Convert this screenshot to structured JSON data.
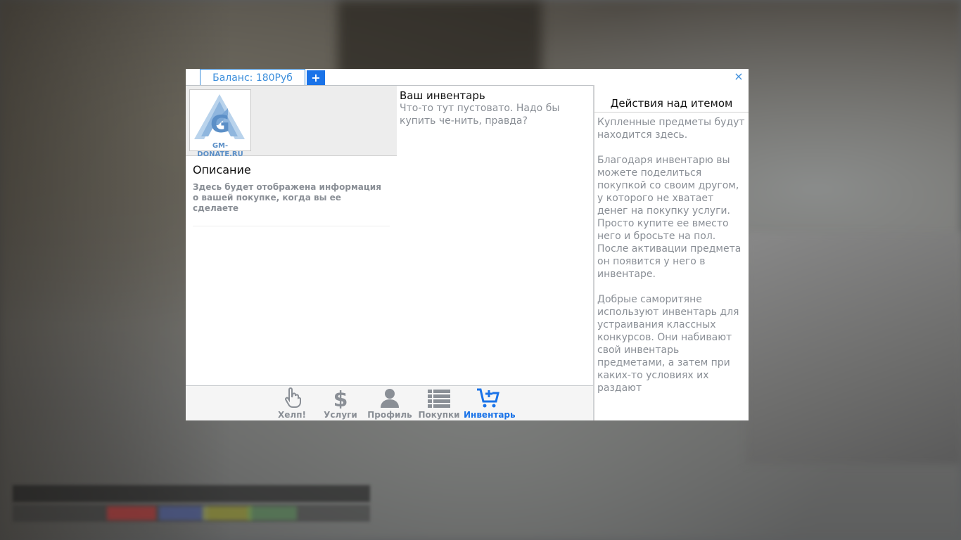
{
  "window": {
    "balance_label": "Баланс: 180Руб",
    "add_balance_label": "+",
    "close_label": "×",
    "accent_color": "#1a73e8"
  },
  "logo": {
    "text": "GM-DONATE.RU",
    "icon": "gm-donate-logo"
  },
  "description": {
    "title": "Описание",
    "text": "Здесь будет отображена информация о вашей покупке, когда вы ее сделаете"
  },
  "inventory": {
    "title": "Ваш инвентарь",
    "empty_text": "Что-то тут пустовато. Надо бы купить че-нить, правда?"
  },
  "actions_panel": {
    "title": "Действия над итемом",
    "paragraphs": [
      "Купленные предметы будут находится здесь.",
      "Благодаря инвентарю вы можете поделиться покупкой со своим другом, у которого не хватает денег на покупку услуги. Просто купите ее вместо него и бросьте на пол. После активации предмета он появится у него в инвентаре.",
      "Добрые саморитяне используют инвентарь для устраивания классных конкурсов. Они набивают свой инвентарь предметами, а затем при каких-то условиях их раздают"
    ]
  },
  "nav": {
    "items": [
      {
        "label": "Хелп!",
        "icon": "hand-pointer-icon",
        "active": false
      },
      {
        "label": "Услуги",
        "icon": "dollar-icon",
        "active": false
      },
      {
        "label": "Профиль",
        "icon": "user-icon",
        "active": false
      },
      {
        "label": "Покупки",
        "icon": "list-icon",
        "active": false
      },
      {
        "label": "Инвентарь",
        "icon": "cart-plus-icon",
        "active": true
      }
    ]
  }
}
